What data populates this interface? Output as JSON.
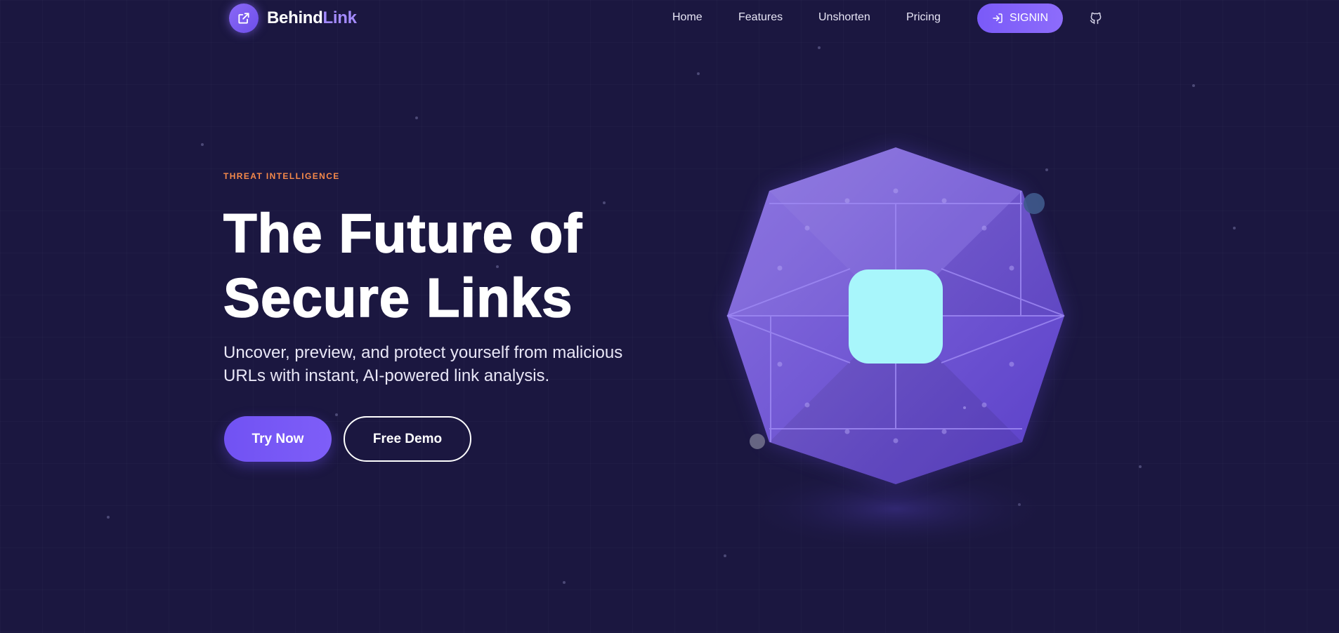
{
  "brand": {
    "name_part1": "Behind",
    "name_part2": "Link",
    "logo_icon": "external-link-icon"
  },
  "nav": {
    "links": [
      "Home",
      "Features",
      "Unshorten",
      "Pricing"
    ],
    "signin_label": "SIGNIN",
    "signin_icon": "sign-in-icon",
    "github_icon": "github-icon"
  },
  "hero": {
    "eyebrow": "THREAT INTELLIGENCE",
    "headline_line1": "The Future of",
    "headline_line2": "Secure Links",
    "subtext_line1": "Uncover, preview, and protect yourself from malicious",
    "subtext_line2": "URLs with instant, AI-powered link analysis.",
    "primary_button": "Try Now",
    "secondary_button": "Free Demo"
  },
  "illustration": {
    "shape": "octagon-shield",
    "core_icon": "cyan-square"
  },
  "colors": {
    "background": "#1b1740",
    "accent_purple": "#7a5af8",
    "eyebrow_orange": "#f5894a",
    "core_cyan": "#a8f6fb"
  }
}
